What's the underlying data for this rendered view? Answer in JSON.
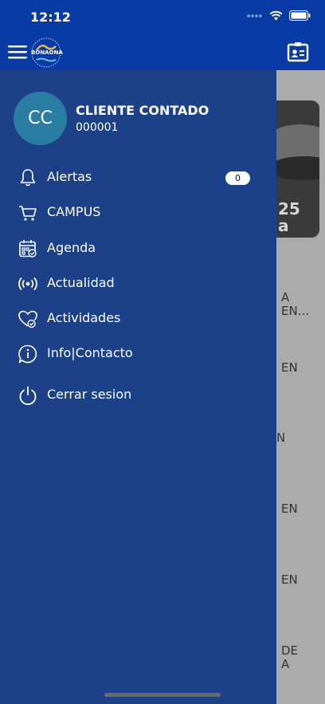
{
  "status_bar": {
    "time": "12:12"
  },
  "header": {
    "logo_text": "BONAONA"
  },
  "user": {
    "initials": "CC",
    "name": "CLIENTE CONTADO",
    "code": "000001"
  },
  "menu": {
    "alerts": {
      "label": "Alertas",
      "badge": "0"
    },
    "campus": {
      "label": "CAMPUS"
    },
    "agenda": {
      "label": "Agenda"
    },
    "news": {
      "label": "Actualidad"
    },
    "activities": {
      "label": "Actividades"
    },
    "info": {
      "label": "Info|Contacto"
    },
    "logout": {
      "label": "Cerrar sesion"
    }
  },
  "background_content": {
    "photo_line1": "25",
    "photo_line2": "a",
    "fragments": [
      "A\nEN...",
      "EN",
      "N",
      "EN",
      "EN",
      "DE\nA"
    ]
  },
  "colors": {
    "primary": "#0a3aa6",
    "drawer": "#1c4189",
    "avatar": "#2b7ea3"
  }
}
